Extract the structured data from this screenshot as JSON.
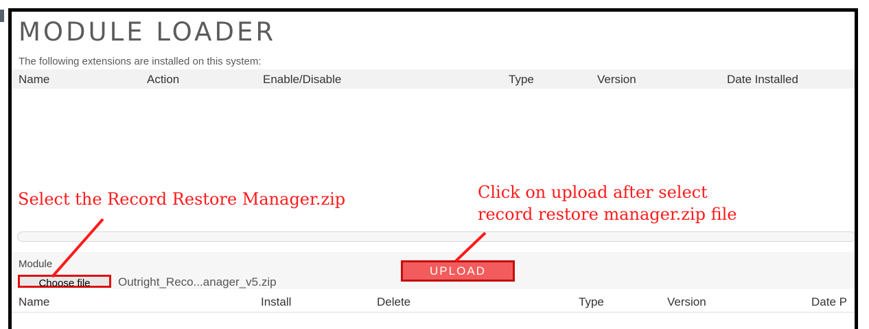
{
  "page": {
    "title": "MODULE LOADER",
    "intro": "The following extensions are installed on this system:"
  },
  "installed_table": {
    "columns": [
      "Name",
      "Action",
      "Enable/Disable",
      "Type",
      "Version",
      "Date Installed"
    ]
  },
  "upload": {
    "module_label": "Module",
    "choose_file_label": "Choose file",
    "selected_file": "Outright_Reco...anager_v5.zip",
    "upload_label": "UPLOAD"
  },
  "packages_table": {
    "columns": [
      "Name",
      "Install",
      "Delete",
      "Type",
      "Version",
      "Date P"
    ]
  },
  "annotations": {
    "select_zip": "Select the Record Restore Manager.zip",
    "click_upload_line1": "Click on upload after select",
    "click_upload_line2": "record restore manager.zip file"
  },
  "colors": {
    "annotation": "#ff1a1a",
    "upload_button": "#f25c5c",
    "frame": "#000000"
  }
}
